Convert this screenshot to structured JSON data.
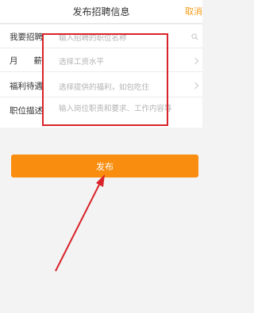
{
  "colors": {
    "accent": "#f39a16",
    "button": "#f88d0f",
    "annotation_red": "#d8232a"
  },
  "header": {
    "title": "发布招聘信息",
    "cancel_label": "取消"
  },
  "form": {
    "rows": [
      {
        "label": "我要招聘",
        "placeholder": "输入招聘的职位名称",
        "icon": "search-icon"
      },
      {
        "label": "月 薪",
        "placeholder": "选择工资水平",
        "icon": "chevron-right-icon"
      },
      {
        "label": "福利待遇",
        "placeholder": "选择提供的福利，如包吃住",
        "icon": "chevron-right-icon"
      },
      {
        "label": "职位描述",
        "placeholder": "输入岗位职责和要求、工作内容等",
        "icon": ""
      }
    ]
  },
  "publish_button": {
    "label": "发布"
  }
}
